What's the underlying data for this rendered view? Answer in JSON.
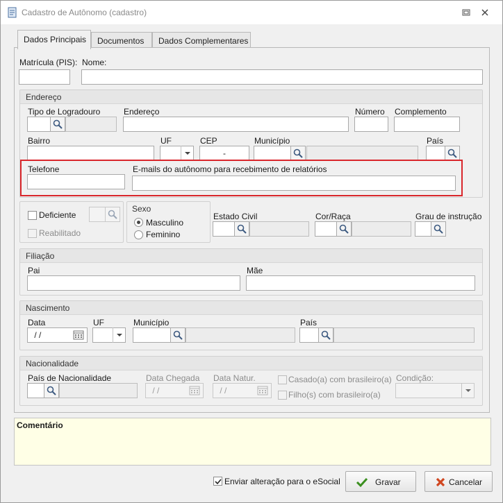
{
  "window": {
    "title": "Cadastro de Autônomo (cadastro)"
  },
  "tabs": [
    {
      "label": "Dados Principais",
      "active": true
    },
    {
      "label": "Documentos",
      "active": false
    },
    {
      "label": "Dados Complementares",
      "active": false
    }
  ],
  "top": {
    "matricula_label": "Matrícula (PIS):",
    "nome_label": "Nome:"
  },
  "endereco": {
    "title": "Endereço",
    "tipo_logradouro_label": "Tipo de Logradouro",
    "endereco_label": "Endereço",
    "numero_label": "Número",
    "complemento_label": "Complemento",
    "bairro_label": "Bairro",
    "uf_label": "UF",
    "cep_label": "CEP",
    "cep_value": "-",
    "municipio_label": "Município",
    "pais_label": "País",
    "telefone_label": "Telefone",
    "emails_label": "E-mails do autônomo para recebimento de relatórios"
  },
  "pessoal": {
    "deficiente_label": "Deficiente",
    "reabilitado_label": "Reabilitado",
    "sexo_title": "Sexo",
    "masculino_label": "Masculino",
    "feminino_label": "Feminino",
    "sexo_selected": "Masculino",
    "estado_civil_label": "Estado Civil",
    "cor_raca_label": "Cor/Raça",
    "grau_instrucao_label": "Grau de instrução"
  },
  "filiacao": {
    "title": "Filiação",
    "pai_label": "Pai",
    "mae_label": "Mãe"
  },
  "nascimento": {
    "title": "Nascimento",
    "data_label": "Data",
    "data_value": " / /",
    "uf_label": "UF",
    "municipio_label": "Município",
    "pais_label": "País"
  },
  "nacionalidade": {
    "title": "Nacionalidade",
    "pais_label": "País de Nacionalidade",
    "data_chegada_label": "Data Chegada",
    "data_chegada_value": " / /",
    "data_natur_label": "Data Natur.",
    "data_natur_value": " / /",
    "casado_label": "Casado(a) com brasileiro(a)",
    "filhos_label": "Filho(s) com brasileiro(a)",
    "condicao_label": "Condição:"
  },
  "comentario": {
    "label": "Comentário"
  },
  "footer": {
    "esocial_label": "Enviar alteração para o eSocial",
    "esocial_checked": true,
    "gravar_label": "Gravar",
    "cancelar_label": "Cancelar"
  },
  "colors": {
    "highlight": "#d9262b",
    "comment_bg": "#ffffe6",
    "gravar_icon": "#3a8f1e",
    "cancelar_icon": "#d0461f"
  }
}
